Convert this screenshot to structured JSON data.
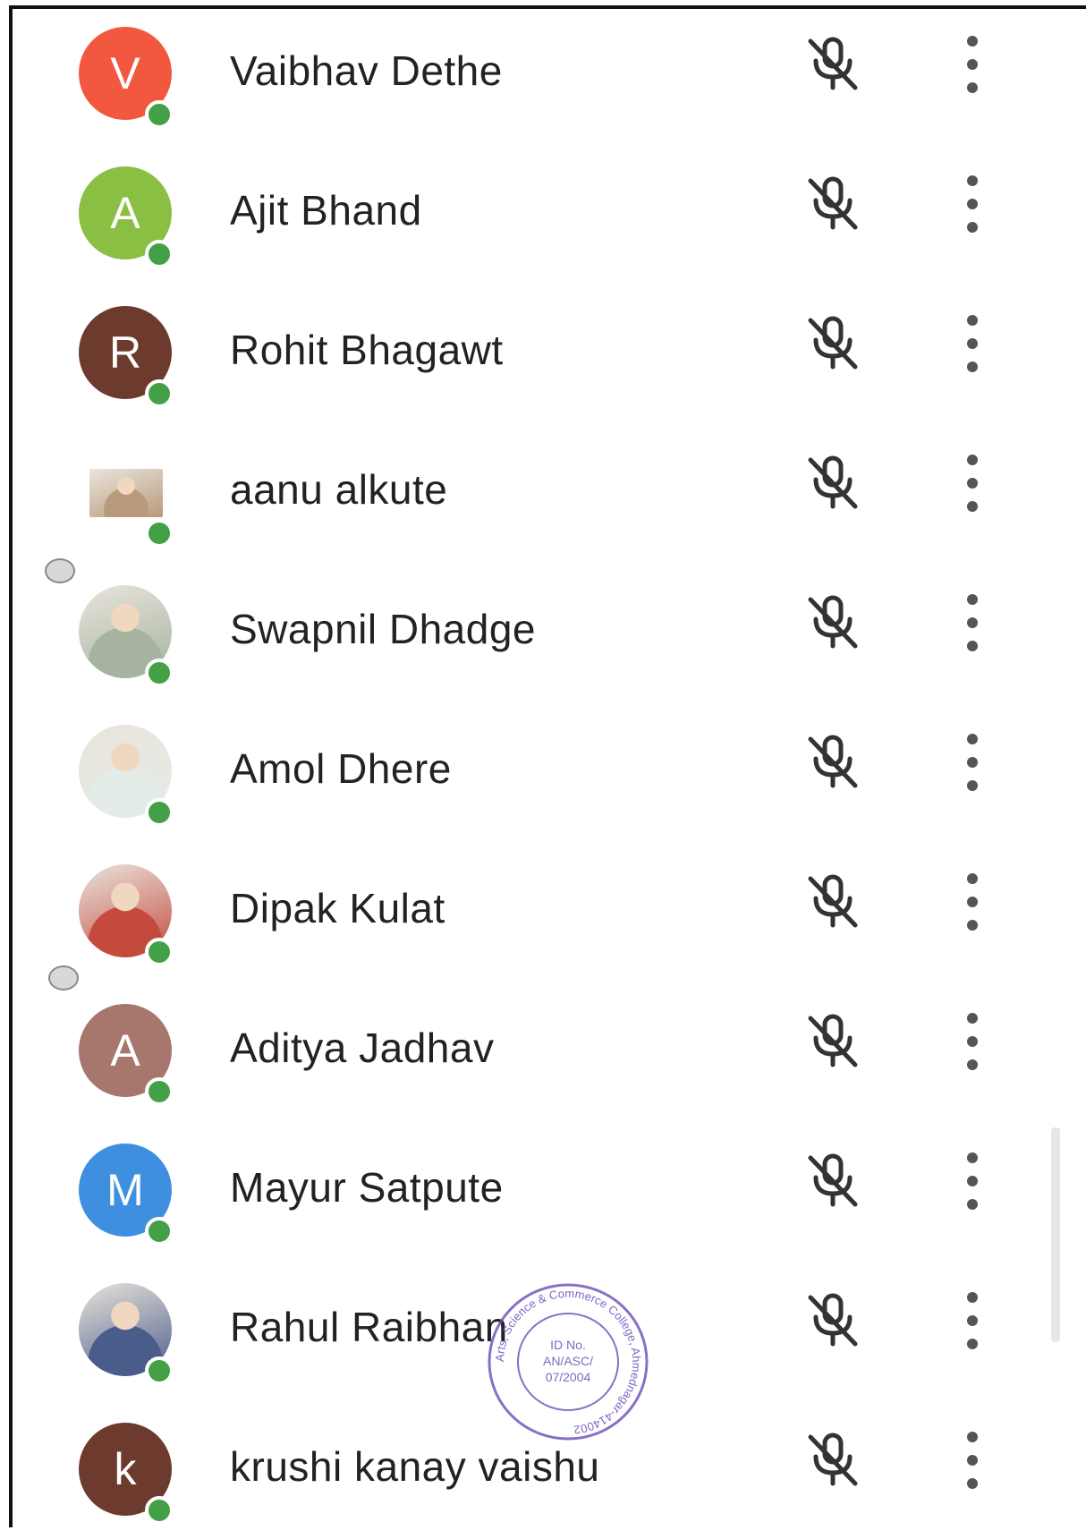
{
  "participants": [
    {
      "name": "Vaibhav Dethe",
      "initial": "V",
      "avatar_color": "#f1583f",
      "avatar_type": "letter"
    },
    {
      "name": "Ajit Bhand",
      "initial": "A",
      "avatar_color": "#8bbf44",
      "avatar_type": "letter"
    },
    {
      "name": "Rohit Bhagawt",
      "initial": "R",
      "avatar_color": "#6d3b2e",
      "avatar_type": "letter"
    },
    {
      "name": "aanu alkute",
      "initial": "",
      "avatar_color": "#b99a7a",
      "avatar_type": "photo-square"
    },
    {
      "name": "Swapnil Dhadge",
      "initial": "",
      "avatar_color": "#a5b3a0",
      "avatar_type": "photo"
    },
    {
      "name": "Amol Dhere",
      "initial": "",
      "avatar_color": "#e3ece6",
      "avatar_type": "photo"
    },
    {
      "name": "Dipak Kulat",
      "initial": "",
      "avatar_color": "#c44a3e",
      "avatar_type": "photo"
    },
    {
      "name": "Aditya Jadhav",
      "initial": "A",
      "avatar_color": "#a7776e",
      "avatar_type": "letter"
    },
    {
      "name": "Mayur Satpute",
      "initial": "M",
      "avatar_color": "#3f8fe0",
      "avatar_type": "letter"
    },
    {
      "name": "Rahul Raibhan",
      "initial": "",
      "avatar_color": "#4a5d8a",
      "avatar_type": "photo"
    },
    {
      "name": "krushi kanay vaishu",
      "initial": "k",
      "avatar_color": "#6d3b2e",
      "avatar_type": "letter"
    }
  ],
  "status_color": "#43a047",
  "icons": {
    "mic": "mic-off-icon",
    "more": "more-vert-icon"
  },
  "stamp": {
    "ring_text": "Arts, Science & Commerce College, Ahmednagar-414002",
    "center_line1": "ID No.",
    "center_line2": "AN/ASC/",
    "center_line3": "07/2004"
  }
}
